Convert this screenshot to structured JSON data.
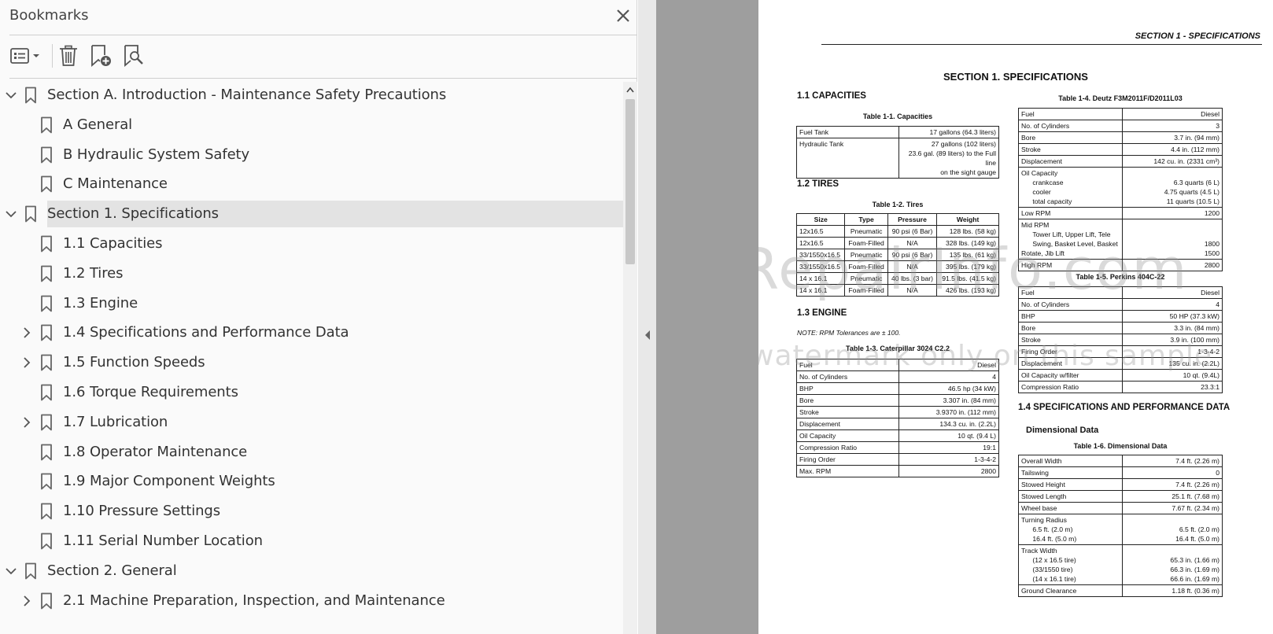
{
  "panel": {
    "title": "Bookmarks",
    "icons": {
      "close": "close-icon",
      "options": "list-options-icon",
      "delete": "trash-icon",
      "add": "bookmark-add-icon",
      "search": "bookmark-search-icon"
    }
  },
  "bookmarks": [
    {
      "label": "Section A. Introduction - Maintenance Safety Precautions",
      "level": 0,
      "toggle": "expanded"
    },
    {
      "label": "A General",
      "level": 1,
      "toggle": "none"
    },
    {
      "label": "B Hydraulic System Safety",
      "level": 1,
      "toggle": "none"
    },
    {
      "label": "C Maintenance",
      "level": 1,
      "toggle": "none"
    },
    {
      "label": "Section 1. Specifications",
      "level": 0,
      "toggle": "expanded",
      "selected": true
    },
    {
      "label": "1.1 Capacities",
      "level": 1,
      "toggle": "none"
    },
    {
      "label": "1.2 Tires",
      "level": 1,
      "toggle": "none"
    },
    {
      "label": "1.3 Engine",
      "level": 1,
      "toggle": "none"
    },
    {
      "label": "1.4 Specifications and Performance Data",
      "level": 1,
      "toggle": "collapsed"
    },
    {
      "label": "1.5 Function Speeds",
      "level": 1,
      "toggle": "collapsed"
    },
    {
      "label": "1.6 Torque Requirements",
      "level": 1,
      "toggle": "none"
    },
    {
      "label": "1.7 Lubrication",
      "level": 1,
      "toggle": "collapsed"
    },
    {
      "label": "1.8 Operator Maintenance",
      "level": 1,
      "toggle": "none"
    },
    {
      "label": "1.9 Major Component Weights",
      "level": 1,
      "toggle": "none"
    },
    {
      "label": "1.10 Pressure Settings",
      "level": 1,
      "toggle": "none"
    },
    {
      "label": "1.11 Serial Number Location",
      "level": 1,
      "toggle": "none"
    },
    {
      "label": "Section 2. General",
      "level": 0,
      "toggle": "expanded"
    },
    {
      "label": "2.1 Machine Preparation, Inspection, and Maintenance",
      "level": 1,
      "toggle": "collapsed"
    }
  ],
  "doc": {
    "running_head": "SECTION 1 - SPECIFICATIONS",
    "section_title": "SECTION 1.  SPECIFICATIONS",
    "h_capacities": "1.1      CAPACITIES",
    "h_tires": "1.2      TIRES",
    "h_engine": "1.3      ENGINE",
    "h_specs": "1.4      SPECIFICATIONS AND PERFORMANCE DATA",
    "h_dimensional": "Dimensional Data",
    "note": "NOTE:      RPM Tolerances are ± 100.",
    "watermark1": "eRepairInfo.com",
    "watermark2": "watermark only on this sample",
    "cap_1_1": "Table 1-1. Capacities",
    "cap_1_2": "Table 1-2. Tires",
    "cap_1_3": "Table 1-3. Caterpillar 3024 C2.2",
    "cap_1_4": "Table 1-4. Deutz F3M2011F/D2011L03",
    "cap_1_5": "Table 1-5. Perkins 404C-22",
    "cap_1_6": "Table 1-6. Dimensional Data",
    "t_capacities": [
      [
        "Fuel Tank",
        "17 gallons (64.3 liters)"
      ],
      [
        "Hydraulic Tank",
        "27 gallons (102 liters)\n23.6 gal. (89 liters) to the Full line\non the sight gauge"
      ]
    ],
    "t_tires_head": [
      "Size",
      "Type",
      "Pressure",
      "Weight"
    ],
    "t_tires": [
      [
        "12x16.5",
        "Pneumatic",
        "90 psi (6 Bar)",
        "128 lbs. (58 kg)"
      ],
      [
        "12x16.5",
        "Foam-Filled",
        "N/A",
        "328 lbs. (149 kg)"
      ],
      [
        "33/1550x16.5",
        "Pneumatic",
        "90 psi (6 Bar)",
        "135 lbs. (61 kg)"
      ],
      [
        "33/1550x16.5",
        "Foam-Filled",
        "N/A",
        "395 lbs. (179 kg)"
      ],
      [
        "14 x 16.1",
        "Pneumatic",
        "40 lbs. (3 bar)",
        "91.5 lbs. (41.5 kg)"
      ],
      [
        "14 x 16.1",
        "Foam-Filled",
        "N/A",
        "426 lbs. (193 kg)"
      ]
    ],
    "t_cat": [
      [
        "Fuel",
        "Diesel"
      ],
      [
        "No. of Cylinders",
        "4"
      ],
      [
        "BHP",
        "46.5 hp (34 kW)"
      ],
      [
        "Bore",
        "3.307 in. (84 mm)"
      ],
      [
        "Stroke",
        "3.9370 in. (112 mm)"
      ],
      [
        "Displacement",
        "134.3 cu. in. (2.2L)"
      ],
      [
        "Oil Capacity",
        "10 qt. (9.4 L)"
      ],
      [
        "Compression Ratio",
        "19:1"
      ],
      [
        "Firing Order",
        "1-3-4-2"
      ],
      [
        "Max. RPM",
        "2800"
      ]
    ],
    "t_deutz": [
      [
        "Fuel",
        "Diesel"
      ],
      [
        "No. of Cylinders",
        "3"
      ],
      [
        "Bore",
        "3.7 in. (94 mm)"
      ],
      [
        "Stroke",
        "4.4 in. (112 mm)"
      ],
      [
        "Displacement",
        "142 cu. in. (2331 cm³)"
      ],
      [
        "Oil Capacity\n   crankcase\n   cooler\n   total capacity",
        "\n6.3 quarts (6 L)\n4.75 quarts (4.5 L)\n11 quarts (10.5 L)"
      ],
      [
        "Low RPM",
        "1200"
      ],
      [
        "Mid RPM\n   Tower Lift, Upper Lift, Tele\n   Swing, Basket Level, Basket\nRotate, Jib Lift",
        "\n\n1800\n1500"
      ],
      [
        "High RPM",
        "2800"
      ]
    ],
    "t_perkins": [
      [
        "Fuel",
        "Diesel"
      ],
      [
        "No. of Cylinders",
        "4"
      ],
      [
        "BHP",
        "50 HP (37.3 kW)"
      ],
      [
        "Bore",
        "3.3 in. (84 mm)"
      ],
      [
        "Stroke",
        "3.9 in. (100 mm)"
      ],
      [
        "Firing Order",
        "1-3-4-2"
      ],
      [
        "Displacement",
        "135 cu. in. (2.2L)"
      ],
      [
        "Oil Capacity w/filter",
        "10 qt. (9.4L)"
      ],
      [
        "Compression Ratio",
        "23.3:1"
      ]
    ],
    "t_dims": [
      [
        "Overall Width",
        "7.4 ft. (2.26 m)"
      ],
      [
        "Tailswing",
        "0"
      ],
      [
        "Stowed Height",
        "7.4 ft. (2.26 m)"
      ],
      [
        "Stowed Length",
        "25.1 ft. (7.68 m)"
      ],
      [
        "Wheel base",
        "7.67 ft. (2.34 m)"
      ],
      [
        "Turning Radius\n   6.5 ft. (2.0 m)\n   16.4 ft. (5.0 m)",
        "\n6.5 ft. (2.0 m)\n16.4 ft. (5.0 m)"
      ],
      [
        "Track Width\n   (12 x 16.5 tire)\n   (33/1550 tire)\n   (14 x 16.1 tire)",
        "\n65.3 in. (1.66 m)\n66.3 in. (1.69 m)\n66.6 in. (1.69 m)"
      ],
      [
        "Ground Clearance",
        "1.18 ft. (0.36 m)"
      ]
    ]
  }
}
